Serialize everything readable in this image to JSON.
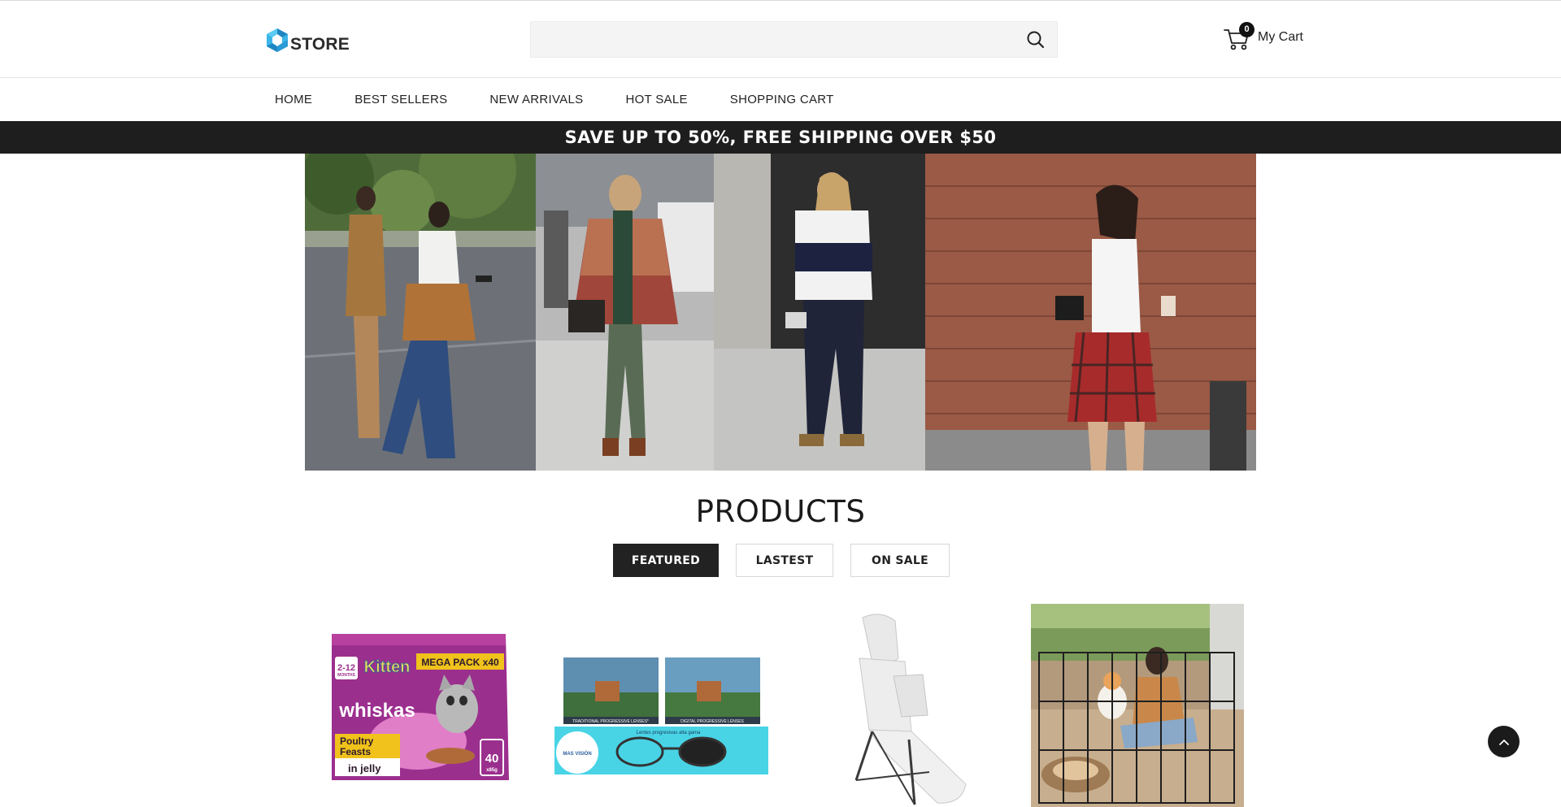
{
  "header": {
    "logo_text": "STORE",
    "search": {
      "value": "",
      "placeholder": ""
    },
    "cart": {
      "count": "0",
      "label": "My Cart"
    }
  },
  "nav": {
    "items": [
      {
        "label": "HOME"
      },
      {
        "label": "BEST SELLERS"
      },
      {
        "label": "NEW ARRIVALS"
      },
      {
        "label": "HOT SALE"
      },
      {
        "label": "SHOPPING CART"
      }
    ]
  },
  "promo": {
    "text": "SAVE UP TO 50%, FREE SHIPPING OVER $50"
  },
  "products": {
    "title": "PRODUCTS",
    "tabs": [
      {
        "label": "FEATURED",
        "active": true
      },
      {
        "label": "LASTEST",
        "active": false
      },
      {
        "label": "ON SALE",
        "active": false
      }
    ],
    "cards": [
      {
        "image": "kitten-food-pack",
        "pack_age": "2-12",
        "pack_age_unit": "MONTHS",
        "pack_name": "Kitten",
        "pack_badge": "MEGA PACK x40",
        "pack_brand": "whiskas",
        "pack_flavor_1": "Poultry",
        "pack_flavor_2": "Feasts",
        "pack_style": "in jelly",
        "pack_count": "40",
        "pack_size": "x85g"
      },
      {
        "image": "progressive-lenses",
        "caption_left": "TRADITIONAL PROGRESSIVE LENSES*",
        "caption_right": "DIGITAL PROGRESSIVE LENSES",
        "banner_text": "Lentes progresivas alta gama",
        "banner_brand": "MAS VISIÓN"
      },
      {
        "image": "folding-salon-chair"
      },
      {
        "image": "dog-playpen"
      }
    ]
  },
  "colors": {
    "brand_blue": "#2fa3d8",
    "dark": "#1e1e1e",
    "tab_active_bg": "#222222"
  }
}
